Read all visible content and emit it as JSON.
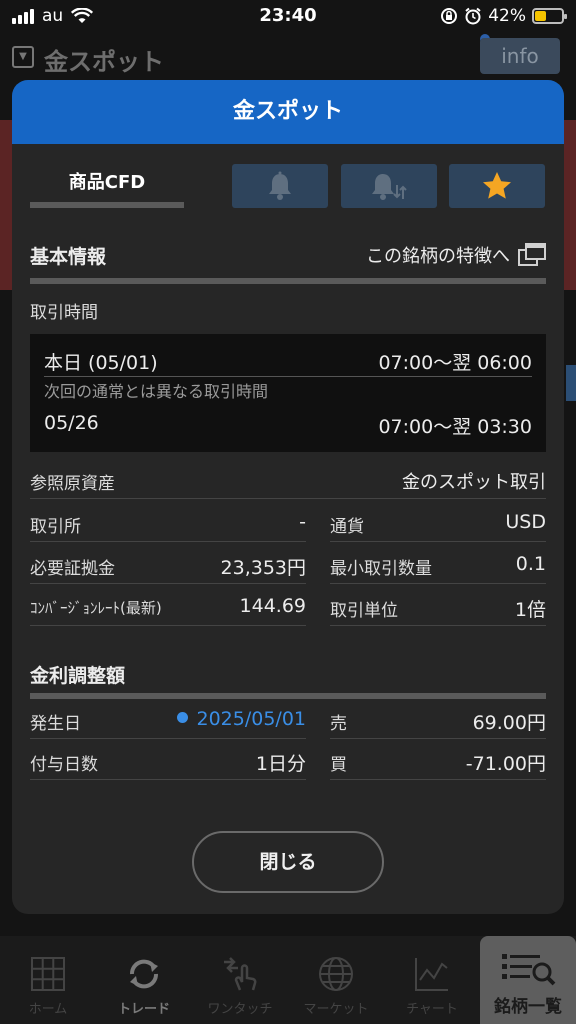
{
  "status_bar": {
    "carrier": "au",
    "time": "23:40",
    "battery": "42%",
    "battery_level": 0.42
  },
  "background": {
    "title": "金スポット",
    "info_label": "info"
  },
  "modal": {
    "title": "金スポット",
    "category_tab": "商品CFD",
    "icons": [
      "bell-icon",
      "bell-arrows-icon",
      "star-icon"
    ],
    "basic_info": {
      "title": "基本情報",
      "feature_link": "この銘柄の特徴へ",
      "trading_hours_label": "取引時間",
      "today_label": "本日 (05/01)",
      "today_hours": "07:00～翌 06:00",
      "next_label": "次回の通常とは異なる取引時間",
      "next_date": "05/26",
      "next_hours": "07:00～翌 03:30",
      "reference_asset_label": "参照原資産",
      "reference_asset_value": "金のスポット取引",
      "exchange_label": "取引所",
      "exchange_value": "-",
      "currency_label": "通貨",
      "currency_value": "USD",
      "margin_label": "必要証拠金",
      "margin_value": "23,353円",
      "min_qty_label": "最小取引数量",
      "min_qty_value": "0.1",
      "conversion_label": "ｺﾝﾊﾞｰｼﾞｮﾝﾚｰﾄ(最新)",
      "conversion_value": "144.69",
      "unit_label": "取引単位",
      "unit_value": "1倍"
    },
    "interest": {
      "title": "金利調整額",
      "date_label": "発生日",
      "date_value": "2025/05/01",
      "sell_label": "売",
      "sell_value": "69.00円",
      "days_label": "付与日数",
      "days_value": "1日分",
      "buy_label": "買",
      "buy_value": "-71.00円"
    },
    "close_label": "閉じる"
  },
  "tabs": [
    {
      "label": "ホーム",
      "icon": "grid-icon"
    },
    {
      "label": "トレード",
      "icon": "refresh-arrows-icon"
    },
    {
      "label": "ワンタッチ",
      "icon": "tap-hand-icon"
    },
    {
      "label": "マーケット",
      "icon": "globe-icon"
    },
    {
      "label": "チャート",
      "icon": "line-chart-icon"
    },
    {
      "label": "銘柄一覧",
      "icon": "list-search-icon"
    }
  ],
  "colors": {
    "header_blue": "#1666c5",
    "link_blue": "#3a8ee6",
    "star": "#f5a623"
  }
}
